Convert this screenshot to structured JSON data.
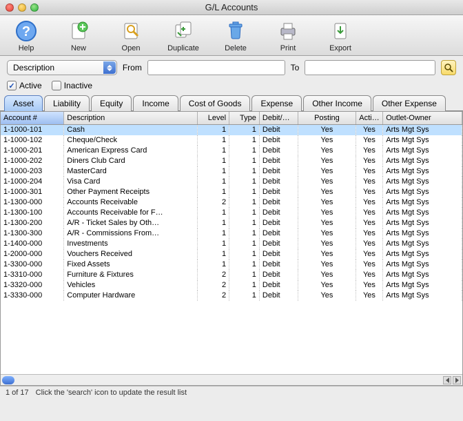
{
  "window": {
    "title": "G/L Accounts"
  },
  "toolbar": [
    {
      "id": "help",
      "label": "Help",
      "icon": "help"
    },
    {
      "id": "new",
      "label": "New",
      "icon": "new"
    },
    {
      "id": "open",
      "label": "Open",
      "icon": "open"
    },
    {
      "id": "duplicate",
      "label": "Duplicate",
      "icon": "duplicate"
    },
    {
      "id": "delete",
      "label": "Delete",
      "icon": "delete"
    },
    {
      "id": "print",
      "label": "Print",
      "icon": "print"
    },
    {
      "id": "export",
      "label": "Export",
      "icon": "export"
    }
  ],
  "filter": {
    "field": "Description",
    "from_label": "From",
    "from_value": "",
    "to_label": "To",
    "to_value": ""
  },
  "checks": {
    "active": {
      "label": "Active",
      "checked": true
    },
    "inactive": {
      "label": "Inactive",
      "checked": false
    }
  },
  "tabs": [
    {
      "id": "asset",
      "label": "Asset",
      "active": true
    },
    {
      "id": "liability",
      "label": "Liability",
      "active": false
    },
    {
      "id": "equity",
      "label": "Equity",
      "active": false
    },
    {
      "id": "income",
      "label": "Income",
      "active": false
    },
    {
      "id": "cogs",
      "label": "Cost of Goods",
      "active": false
    },
    {
      "id": "expense",
      "label": "Expense",
      "active": false
    },
    {
      "id": "other-income",
      "label": "Other Income",
      "active": false
    },
    {
      "id": "other-expense",
      "label": "Other Expense",
      "active": false
    }
  ],
  "columns": [
    {
      "id": "account",
      "label": "Account #"
    },
    {
      "id": "description",
      "label": "Description"
    },
    {
      "id": "level",
      "label": "Level"
    },
    {
      "id": "type",
      "label": "Type"
    },
    {
      "id": "debit",
      "label": "Debit/…"
    },
    {
      "id": "posting",
      "label": "Posting"
    },
    {
      "id": "active",
      "label": "Acti…"
    },
    {
      "id": "owner",
      "label": "Outlet-Owner"
    }
  ],
  "rows": [
    {
      "account": "1-1000-101",
      "description": "Cash",
      "level": 1,
      "type": 1,
      "dc": "Debit",
      "posting": "Yes",
      "active": "Yes",
      "owner": "Arts Mgt Sys",
      "selected": true
    },
    {
      "account": "1-1000-102",
      "description": "Cheque/Check",
      "level": 1,
      "type": 1,
      "dc": "Debit",
      "posting": "Yes",
      "active": "Yes",
      "owner": "Arts Mgt Sys"
    },
    {
      "account": "1-1000-201",
      "description": "American Express Card",
      "level": 1,
      "type": 1,
      "dc": "Debit",
      "posting": "Yes",
      "active": "Yes",
      "owner": "Arts Mgt Sys"
    },
    {
      "account": "1-1000-202",
      "description": "Diners Club Card",
      "level": 1,
      "type": 1,
      "dc": "Debit",
      "posting": "Yes",
      "active": "Yes",
      "owner": "Arts Mgt Sys"
    },
    {
      "account": "1-1000-203",
      "description": "MasterCard",
      "level": 1,
      "type": 1,
      "dc": "Debit",
      "posting": "Yes",
      "active": "Yes",
      "owner": "Arts Mgt Sys"
    },
    {
      "account": "1-1000-204",
      "description": "Visa Card",
      "level": 1,
      "type": 1,
      "dc": "Debit",
      "posting": "Yes",
      "active": "Yes",
      "owner": "Arts Mgt Sys"
    },
    {
      "account": "1-1000-301",
      "description": "Other Payment Receipts",
      "level": 1,
      "type": 1,
      "dc": "Debit",
      "posting": "Yes",
      "active": "Yes",
      "owner": "Arts Mgt Sys"
    },
    {
      "account": "1-1300-000",
      "description": "Accounts Receivable",
      "level": 2,
      "type": 1,
      "dc": "Debit",
      "posting": "Yes",
      "active": "Yes",
      "owner": "Arts Mgt Sys"
    },
    {
      "account": "1-1300-100",
      "description": "Accounts Receivable for F…",
      "level": 1,
      "type": 1,
      "dc": "Debit",
      "posting": "Yes",
      "active": "Yes",
      "owner": "Arts Mgt Sys"
    },
    {
      "account": "1-1300-200",
      "description": "A/R - Ticket Sales by Oth…",
      "level": 1,
      "type": 1,
      "dc": "Debit",
      "posting": "Yes",
      "active": "Yes",
      "owner": "Arts Mgt Sys"
    },
    {
      "account": "1-1300-300",
      "description": "A/R - Commissions From…",
      "level": 1,
      "type": 1,
      "dc": "Debit",
      "posting": "Yes",
      "active": "Yes",
      "owner": "Arts Mgt Sys"
    },
    {
      "account": "1-1400-000",
      "description": "Investments",
      "level": 1,
      "type": 1,
      "dc": "Debit",
      "posting": "Yes",
      "active": "Yes",
      "owner": "Arts Mgt Sys"
    },
    {
      "account": "1-2000-000",
      "description": "Vouchers Received",
      "level": 1,
      "type": 1,
      "dc": "Debit",
      "posting": "Yes",
      "active": "Yes",
      "owner": "Arts Mgt Sys"
    },
    {
      "account": "1-3300-000",
      "description": "Fixed Assets",
      "level": 1,
      "type": 1,
      "dc": "Debit",
      "posting": "Yes",
      "active": "Yes",
      "owner": "Arts Mgt Sys"
    },
    {
      "account": "1-3310-000",
      "description": "Furniture & Fixtures",
      "level": 2,
      "type": 1,
      "dc": "Debit",
      "posting": "Yes",
      "active": "Yes",
      "owner": "Arts Mgt Sys"
    },
    {
      "account": "1-3320-000",
      "description": "Vehicles",
      "level": 2,
      "type": 1,
      "dc": "Debit",
      "posting": "Yes",
      "active": "Yes",
      "owner": "Arts Mgt Sys"
    },
    {
      "account": "1-3330-000",
      "description": "Computer Hardware",
      "level": 2,
      "type": 1,
      "dc": "Debit",
      "posting": "Yes",
      "active": "Yes",
      "owner": "Arts Mgt Sys"
    }
  ],
  "status": {
    "count": "1 of 17",
    "hint": "Click the 'search' icon to update the result list"
  }
}
